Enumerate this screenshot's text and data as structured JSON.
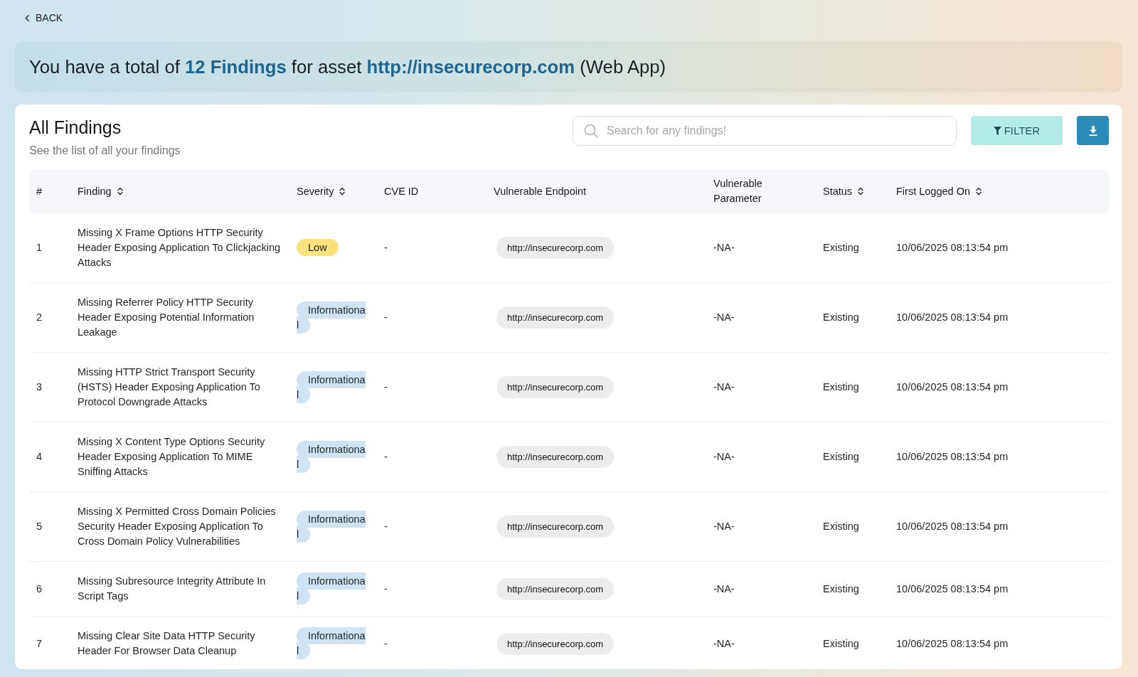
{
  "back_button": {
    "label": "BACK"
  },
  "banner": {
    "text": "You have a total of **12 Findings** for asset **http://insecurecorp.com** (Web App)"
  },
  "findings_panel": {
    "title": "All Findings",
    "subtitle": "See the list of all your findings",
    "search": {
      "placeholder": "Search for any findings!"
    },
    "filter_button": {
      "label": "FILTER"
    },
    "table": {
      "columns": [
        {
          "label": "#",
          "sortable": false
        },
        {
          "label": "Finding",
          "sortable": true
        },
        {
          "label": "Severity",
          "sortable": true
        },
        {
          "label": "CVE ID",
          "sortable": false
        },
        {
          "label": "Vulnerable Endpoint",
          "sortable": false
        },
        {
          "label": "Vulnerable Parameter",
          "sortable": false
        },
        {
          "label": "Status",
          "sortable": true
        },
        {
          "label": "First Logged On",
          "sortable": true
        }
      ],
      "rows": [
        {
          "number": "1",
          "finding": "Missing X Frame Options HTTP Security Header Exposing Application To Clickjacking Attacks",
          "severity": {
            "label": "Low",
            "color": "#fce27c"
          },
          "cve_id": "-",
          "endpoint": "http://insecurecorp.com",
          "parameter": "-NA-",
          "status": "Existing",
          "first_logged_on": "10/06/2025 08:13:54 pm"
        },
        {
          "number": "2",
          "finding": "Missing Referrer Policy HTTP Security Header Exposing Potential Information Leakage",
          "severity": {
            "label": "Informational",
            "color": "#cfe3f3"
          },
          "cve_id": "-",
          "endpoint": "http://insecurecorp.com",
          "parameter": "-NA-",
          "status": "Existing",
          "first_logged_on": "10/06/2025 08:13:54 pm"
        },
        {
          "number": "3",
          "finding": "Missing HTTP Strict Transport Security (HSTS) Header Exposing Application To Protocol Downgrade Attacks",
          "severity": {
            "label": "Informational",
            "color": "#cfe3f3"
          },
          "cve_id": "-",
          "endpoint": "http://insecurecorp.com",
          "parameter": "-NA-",
          "status": "Existing",
          "first_logged_on": "10/06/2025 08:13:54 pm"
        },
        {
          "number": "4",
          "finding": "Missing X Content Type Options Security Header Exposing Application To MIME Sniffing Attacks",
          "severity": {
            "label": "Informational",
            "color": "#cfe3f3"
          },
          "cve_id": "-",
          "endpoint": "http://insecurecorp.com",
          "parameter": "-NA-",
          "status": "Existing",
          "first_logged_on": "10/06/2025 08:13:54 pm"
        },
        {
          "number": "5",
          "finding": "Missing X Permitted Cross Domain Policies Security Header Exposing Application To Cross Domain Policy Vulnerabilities",
          "severity": {
            "label": "Informational",
            "color": "#cfe3f3"
          },
          "cve_id": "-",
          "endpoint": "http://insecurecorp.com",
          "parameter": "-NA-",
          "status": "Existing",
          "first_logged_on": "10/06/2025 08:13:54 pm"
        },
        {
          "number": "6",
          "finding": "Missing Subresource Integrity Attribute In Script Tags",
          "severity": {
            "label": "Informational",
            "color": "#cfe3f3"
          },
          "cve_id": "-",
          "endpoint": "http://insecurecorp.com",
          "parameter": "-NA-",
          "status": "Existing",
          "first_logged_on": "10/06/2025 08:13:54 pm"
        },
        {
          "number": "7",
          "finding": "Missing Clear Site Data HTTP Security Header For Browser Data Cleanup",
          "severity": {
            "label": "Informational",
            "color": "#cfe3f3"
          },
          "cve_id": "-",
          "endpoint": "http://insecurecorp.com",
          "parameter": "-NA-",
          "status": "Existing",
          "first_logged_on": "10/06/2025 08:13:54 pm"
        }
      ]
    }
  }
}
